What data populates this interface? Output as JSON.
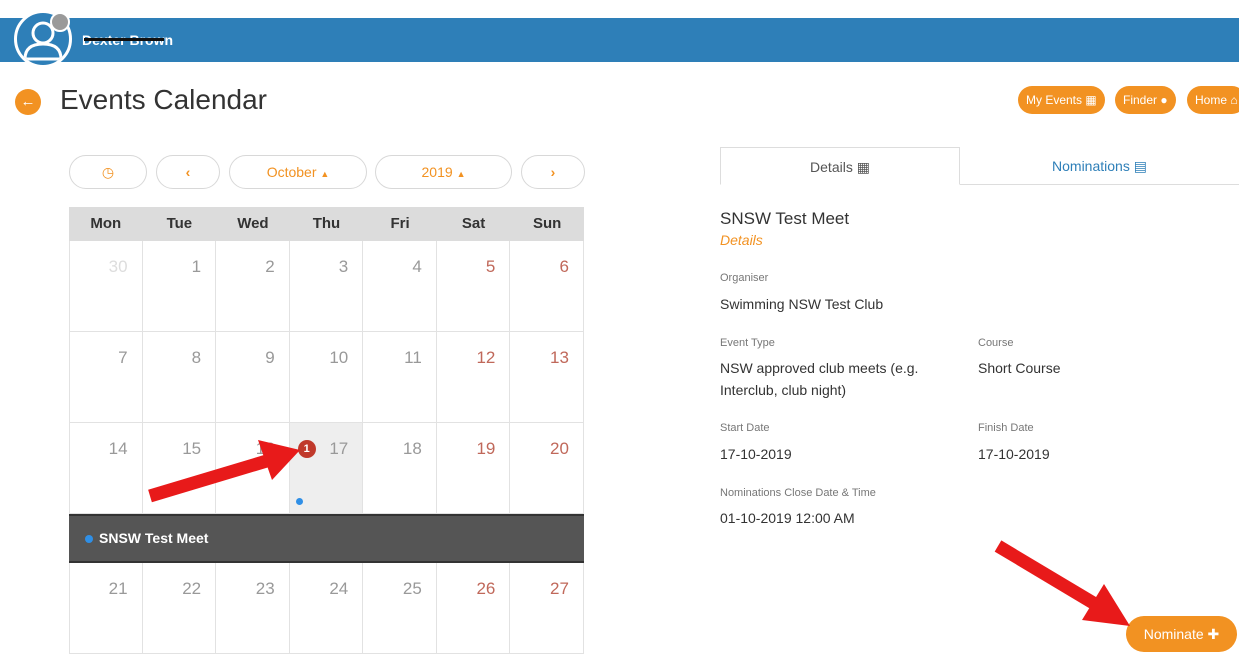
{
  "header": {
    "username": "Dexter Brown"
  },
  "page": {
    "title": "Events Calendar",
    "back_icon": "arrow-left-icon"
  },
  "top_nav": [
    {
      "label": "My Events",
      "icon": "calendar-icon"
    },
    {
      "label": "Finder",
      "icon": "map-pin-icon"
    },
    {
      "label": "Home",
      "icon": "home-icon"
    }
  ],
  "calendar_nav": {
    "today_icon": "clock-icon",
    "prev_icon": "chevron-left-icon",
    "month": "October",
    "year": "2019",
    "next_icon": "chevron-right-icon"
  },
  "calendar": {
    "weekdays": [
      "Mon",
      "Tue",
      "Wed",
      "Thu",
      "Fri",
      "Sat",
      "Sun"
    ],
    "weeks": [
      [
        "30",
        "1",
        "2",
        "3",
        "4",
        "5",
        "6"
      ],
      [
        "7",
        "8",
        "9",
        "10",
        "11",
        "12",
        "13"
      ],
      [
        "14",
        "15",
        "16",
        "17",
        "18",
        "19",
        "20"
      ],
      [
        "21",
        "22",
        "23",
        "24",
        "25",
        "26",
        "27"
      ]
    ],
    "selected_badge": "1",
    "event_name": "SNSW Test Meet"
  },
  "tabs": {
    "details": "Details",
    "nominations": "Nominations"
  },
  "event": {
    "title": "SNSW Test Meet",
    "subtitle": "Details",
    "organiser_label": "Organiser",
    "organiser": "Swimming NSW Test Club",
    "event_type_label": "Event Type",
    "event_type_line1": "NSW approved club meets (e.g.",
    "event_type_line2": "Interclub, club night)",
    "course_label": "Course",
    "course": "Short Course",
    "start_label": "Start Date",
    "start": "17-10-2019",
    "finish_label": "Finish Date",
    "finish": "17-10-2019",
    "close_label": "Nominations Close Date & Time",
    "close": "01-10-2019 12:00 AM"
  },
  "nominate_button": "Nominate",
  "colors": {
    "header_blue": "#2e7fb8",
    "accent_orange": "#f29222",
    "weekend_red": "#c0685a",
    "badge_red": "#c0392b",
    "event_dot": "#2f8fe6",
    "annotation_arrow": "#e81a1a"
  }
}
